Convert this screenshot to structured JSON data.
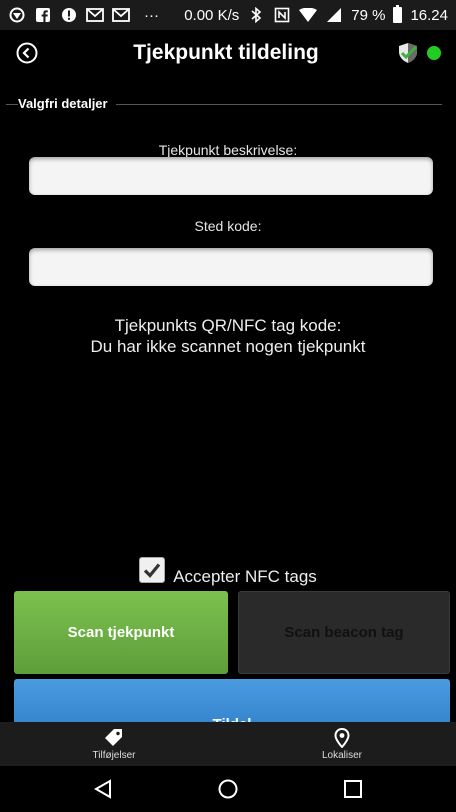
{
  "status_bar": {
    "network_speed": "0.00 K/s",
    "dots": "···",
    "battery_percent": "79 %",
    "time": "16.24"
  },
  "app_bar": {
    "title": "Tjekpunkt tildeling"
  },
  "section": {
    "legend": "Valgfri detaljer"
  },
  "form": {
    "description_label": "Tjekpunkt beskrivelse:",
    "description_value": "",
    "location_label": "Sted kode:",
    "location_value": ""
  },
  "tag_info": {
    "line1": "Tjekpunkts QR/NFC tag kode:",
    "line2": "Du har ikke scannet nogen tjekpunkt"
  },
  "nfc": {
    "label": "Accepter NFC tags",
    "checked": true
  },
  "buttons": {
    "scan_checkpoint": "Scan tjekpunkt",
    "scan_beacon": "Scan beacon tag",
    "assign": "Tildel"
  },
  "bottom_nav": {
    "left_label": "Tilføjelser",
    "right_label": "Lokaliser"
  },
  "colors": {
    "green": "#6cb145",
    "blue": "#3a8cd6",
    "status_dot": "#22cc22"
  }
}
